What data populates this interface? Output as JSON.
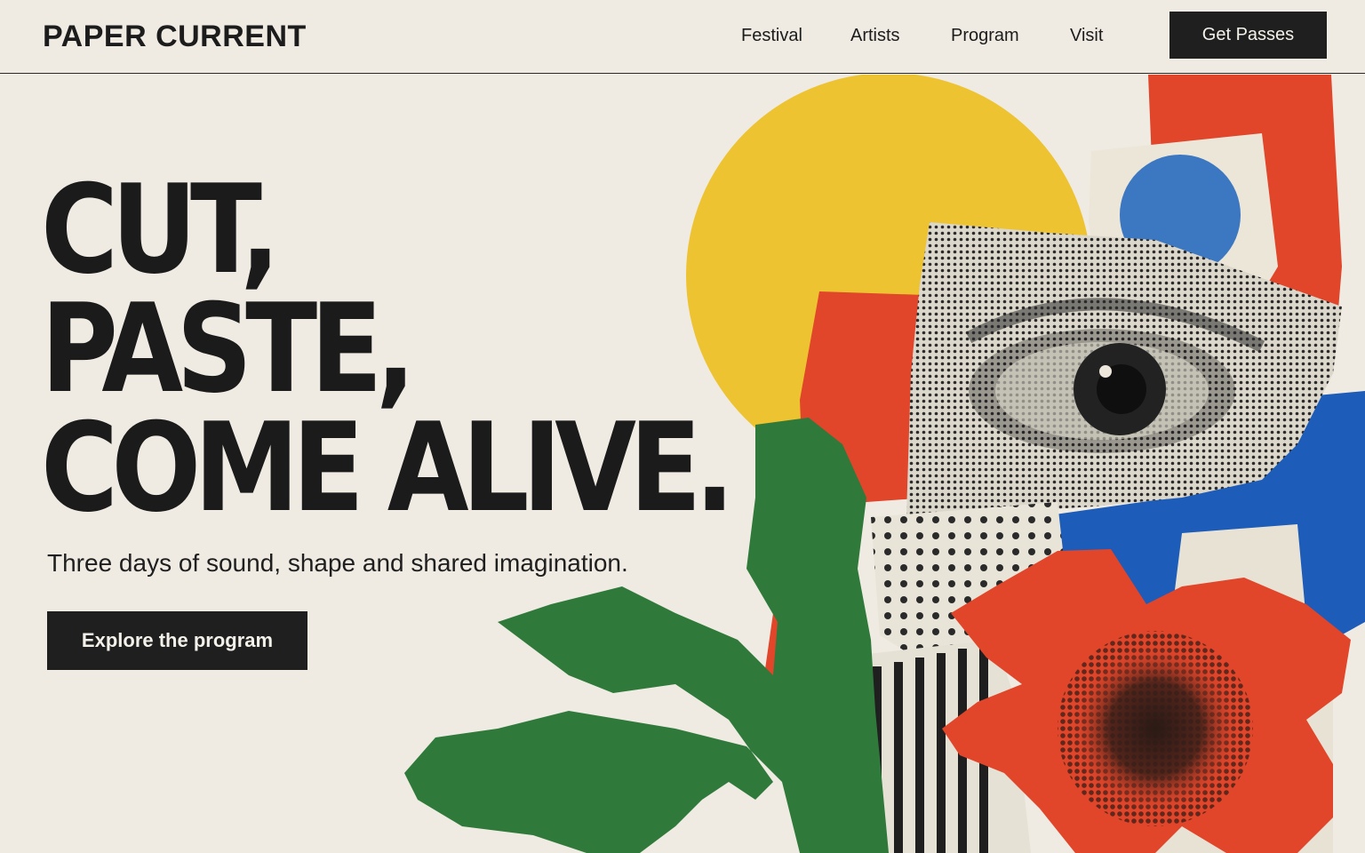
{
  "header": {
    "logo": "PAPER CURRENT",
    "nav": {
      "festival": "Festival",
      "artists": "Artists",
      "program": "Program",
      "visit": "Visit"
    },
    "cta": "Get Passes"
  },
  "hero": {
    "headline": [
      "CUT,",
      "PASTE,",
      "COME ALIVE."
    ],
    "subtitle": "Three days of sound, shape and shared imagination.",
    "cta": "Explore the program"
  },
  "colors": {
    "background": "#efebe2",
    "ink": "#1c1c1c",
    "yellow": "#eec331",
    "red": "#e1452a",
    "blue": "#1d5cb8",
    "green": "#2f7a3a"
  },
  "artwork": {
    "elements": [
      "paper-collage",
      "yellow-circle",
      "red-strip",
      "blue-circle",
      "halftone-eye",
      "green-leaf",
      "red-flower",
      "dot-pattern",
      "stripe-pattern"
    ]
  }
}
